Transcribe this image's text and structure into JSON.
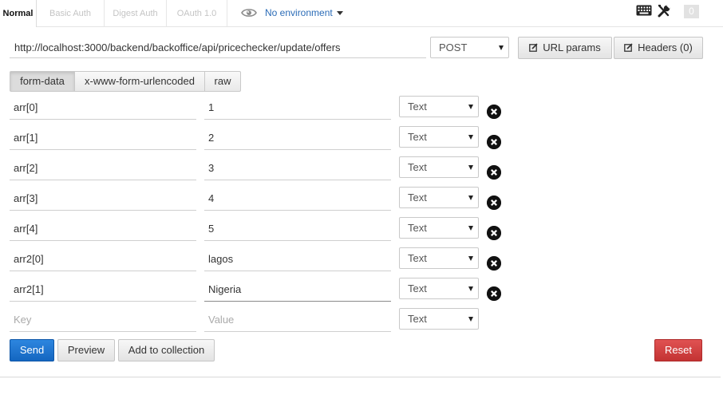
{
  "auth_tabs": [
    {
      "label": "Normal",
      "active": true
    },
    {
      "label": "Basic Auth",
      "active": false
    },
    {
      "label": "Digest Auth",
      "active": false
    },
    {
      "label": "OAuth 1.0",
      "active": false
    }
  ],
  "environment": {
    "label": "No environment",
    "icon": "eye-icon"
  },
  "toolbar": {
    "keyboard_icon": "keyboard-icon",
    "tools_icon": "wrench-screwdriver-icon",
    "counter": "0"
  },
  "request": {
    "url": "http://localhost:3000/backend/backoffice/api/pricechecker/update/offers",
    "method": "POST",
    "url_params_label": "URL params",
    "headers_label": "Headers (0)"
  },
  "body_types": [
    {
      "label": "form-data",
      "active": true
    },
    {
      "label": "x-www-form-urlencoded",
      "active": false
    },
    {
      "label": "raw",
      "active": false
    }
  ],
  "form_rows": [
    {
      "key": "arr[0]",
      "value": "1",
      "type": "Text"
    },
    {
      "key": "arr[1]",
      "value": "2",
      "type": "Text"
    },
    {
      "key": "arr[2]",
      "value": "3",
      "type": "Text"
    },
    {
      "key": "arr[3]",
      "value": "4",
      "type": "Text"
    },
    {
      "key": "arr[4]",
      "value": "5",
      "type": "Text"
    },
    {
      "key": "arr2[0]",
      "value": "lagos",
      "type": "Text"
    },
    {
      "key": "arr2[1]",
      "value": "Nigeria",
      "type": "Text"
    }
  ],
  "new_row": {
    "key_placeholder": "Key",
    "value_placeholder": "Value",
    "type": "Text"
  },
  "actions": {
    "send": "Send",
    "preview": "Preview",
    "add_to_collection": "Add to collection",
    "reset": "Reset"
  },
  "colors": {
    "send": "#1a6fcc",
    "reset": "#d04141",
    "link": "#2b6cb7"
  }
}
